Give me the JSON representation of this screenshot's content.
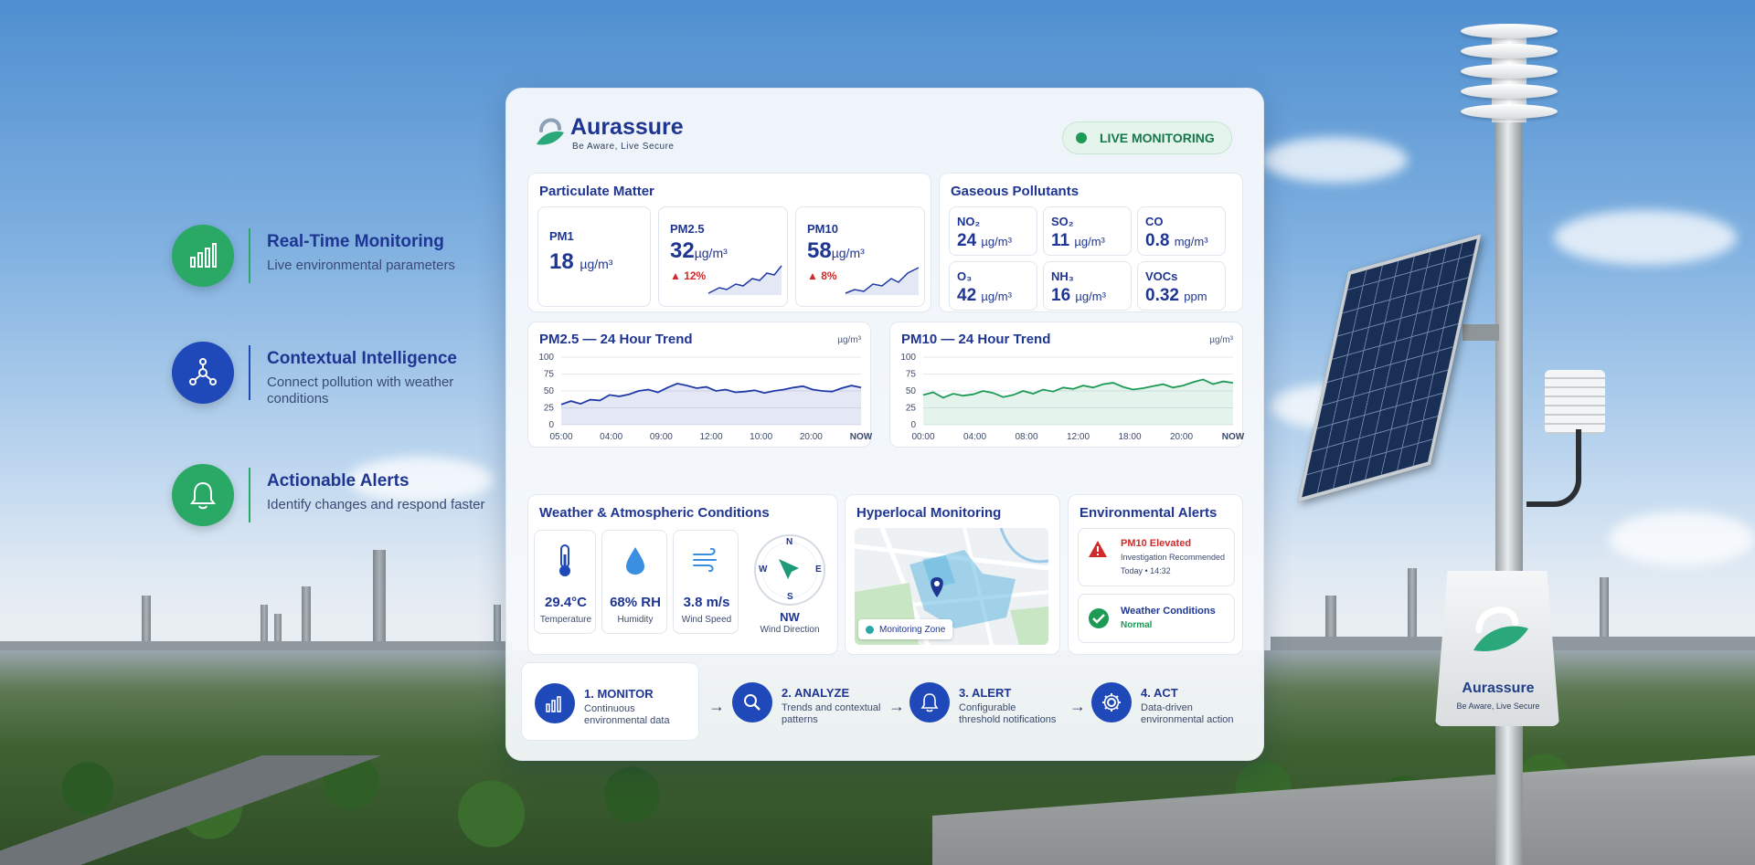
{
  "brand": {
    "name": "Aurassure",
    "tagline": "Be Aware, Live Secure"
  },
  "status": {
    "live_label": "LIVE MONITORING"
  },
  "features": [
    {
      "title": "Real-Time Monitoring",
      "desc": "Live environmental parameters",
      "icon": "bar-chart-icon",
      "color": "#2aa866"
    },
    {
      "title": "Contextual Intelligence",
      "desc": "Connect pollution with weather conditions",
      "icon": "network-icon",
      "color": "#1f48b8"
    },
    {
      "title": "Actionable Alerts",
      "desc": "Identify changes and respond faster",
      "icon": "bell-icon",
      "color": "#2aa866"
    }
  ],
  "particulate": {
    "title": "Particulate Matter",
    "items": [
      {
        "label": "PM1",
        "value": "18",
        "unit": "µg/m³",
        "delta": ""
      },
      {
        "label": "PM2.5",
        "value": "32",
        "unit": "µg/m³",
        "delta": "▲ 12%"
      },
      {
        "label": "PM10",
        "value": "58",
        "unit": "µg/m³",
        "delta": "▲ 8%"
      }
    ]
  },
  "gaseous": {
    "title": "Gaseous Pollutants",
    "items": [
      {
        "label": "NO₂",
        "value": "24",
        "unit": "µg/m³"
      },
      {
        "label": "SO₂",
        "value": "11",
        "unit": "µg/m³"
      },
      {
        "label": "CO",
        "value": "0.8",
        "unit": "mg/m³"
      },
      {
        "label": "O₃",
        "value": "42",
        "unit": "µg/m³"
      },
      {
        "label": "NH₃",
        "value": "16",
        "unit": "µg/m³"
      },
      {
        "label": "VOCs",
        "value": "0.32",
        "unit": "ppm"
      }
    ]
  },
  "chart_data": [
    {
      "type": "area",
      "title": "PM2.5 — 24 Hour Trend",
      "unit": "µg/m³",
      "x": [
        "05:00",
        "04:00",
        "09:00",
        "12:00",
        "10:00",
        "20:00",
        "NOW"
      ],
      "ylim": [
        0,
        100
      ],
      "yticks": [
        100,
        75,
        50,
        25,
        0
      ],
      "color": "#1f3aa8",
      "series": [
        {
          "values": [
            30,
            35,
            31,
            37,
            36,
            44,
            42,
            45,
            50,
            52,
            48,
            55,
            61,
            58,
            54,
            56,
            50,
            52,
            48,
            49,
            51,
            47,
            50,
            52,
            55,
            57,
            52,
            50,
            49,
            54,
            58,
            55
          ]
        }
      ]
    },
    {
      "type": "area",
      "title": "PM10 — 24 Hour Trend",
      "unit": "µg/m³",
      "x": [
        "00:00",
        "04:00",
        "08:00",
        "12:00",
        "18:00",
        "20:00",
        "NOW"
      ],
      "ylim": [
        0,
        100
      ],
      "yticks": [
        100,
        75,
        50,
        25,
        0
      ],
      "color": "#1e9a57",
      "series": [
        {
          "values": [
            44,
            48,
            40,
            46,
            43,
            45,
            50,
            47,
            41,
            44,
            50,
            46,
            52,
            49,
            55,
            53,
            58,
            55,
            60,
            62,
            56,
            52,
            54,
            57,
            60,
            55,
            58,
            63,
            67,
            60,
            64,
            62
          ]
        }
      ]
    }
  ],
  "weather": {
    "title": "Weather & Atmospheric Conditions",
    "items": [
      {
        "value": "29.4°C",
        "label": "Temperature",
        "icon": "thermometer-icon"
      },
      {
        "value": "68% RH",
        "label": "Humidity",
        "icon": "droplet-icon"
      },
      {
        "value": "3.8 m/s",
        "label": "Wind Speed",
        "icon": "wind-icon"
      }
    ],
    "compass": {
      "n": "N",
      "s": "S",
      "e": "E",
      "w": "W",
      "direction": "NW",
      "label": "Wind Direction"
    }
  },
  "hyperlocal": {
    "title": "Hyperlocal Monitoring",
    "zone_label": "Monitoring Zone"
  },
  "alerts": {
    "title": "Environmental Alerts",
    "items": [
      {
        "title": "PM10 Elevated",
        "desc": "Investigation Recommended",
        "time": "Today • 14:32",
        "type": "warning",
        "color": "#d12a2a"
      },
      {
        "title": "Weather Conditions",
        "desc": "Normal",
        "type": "ok",
        "color": "#1e9a57"
      }
    ]
  },
  "steps": [
    {
      "title": "1. MONITOR",
      "desc": "Continuous environmental data",
      "icon": "bar-chart-icon"
    },
    {
      "title": "2. ANALYZE",
      "desc": "Trends and contextual patterns",
      "icon": "magnifier-icon"
    },
    {
      "title": "3. ALERT",
      "desc": "Configurable threshold notifications",
      "icon": "bell-icon"
    },
    {
      "title": "4. ACT",
      "desc": "Data-driven environmental action",
      "icon": "gear-icon"
    }
  ]
}
